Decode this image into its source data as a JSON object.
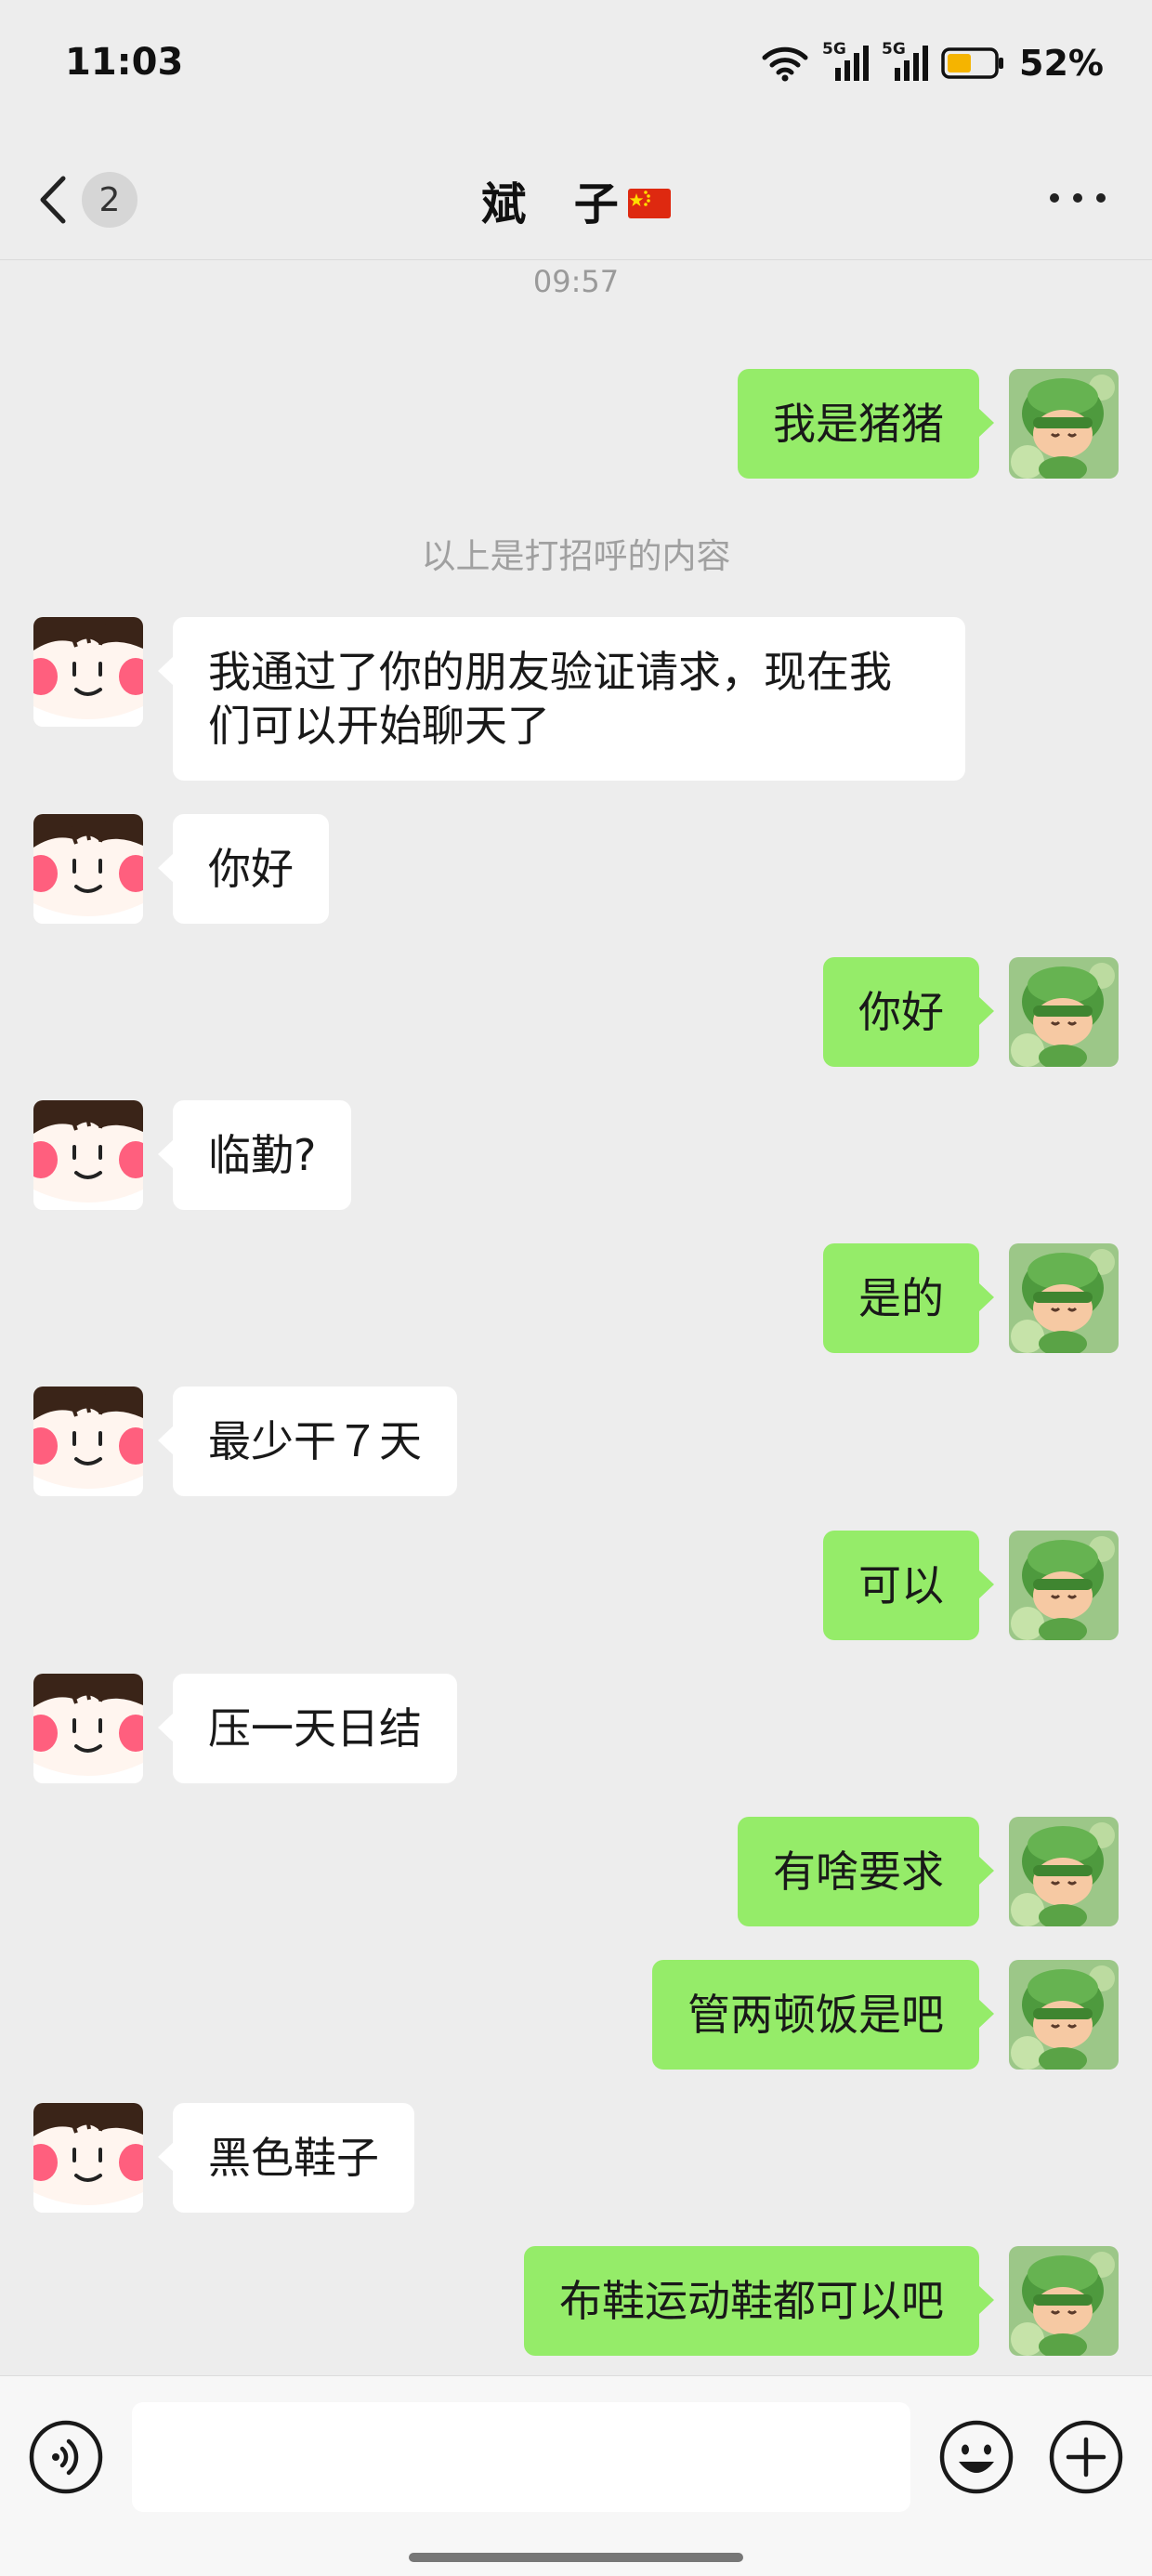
{
  "status_bar": {
    "time": "11:03",
    "network_1": "5G",
    "network_2": "5G",
    "battery_percent": "52%",
    "battery_level": 0.52,
    "battery_color": "#f5b400"
  },
  "nav": {
    "unread_count": "2",
    "title": "斌  子",
    "title_flag": "china-flag-icon"
  },
  "chat": {
    "timestamp": "09:57",
    "system_note": "以上是打招呼的内容",
    "messages": [
      {
        "side": "right",
        "text": "我是猪猪"
      },
      {
        "side": "left",
        "text": "我通过了你的朋友验证请求，现在我们可以开始聊天了"
      },
      {
        "side": "left",
        "text": "你好"
      },
      {
        "side": "right",
        "text": "你好"
      },
      {
        "side": "left",
        "text": "临勤?"
      },
      {
        "side": "right",
        "text": "是的"
      },
      {
        "side": "left",
        "text": "最少干７天"
      },
      {
        "side": "right",
        "text": "可以"
      },
      {
        "side": "left",
        "text": "压一天日结"
      },
      {
        "side": "right",
        "text": "有啥要求"
      },
      {
        "side": "right",
        "text": "管两顿饭是吧"
      },
      {
        "side": "left",
        "text": "黑色鞋子"
      },
      {
        "side": "right",
        "text": "布鞋运动鞋都可以吧"
      }
    ]
  },
  "colors": {
    "sent_bubble": "#95ec69",
    "received_bubble": "#ffffff",
    "background": "#ededed"
  }
}
